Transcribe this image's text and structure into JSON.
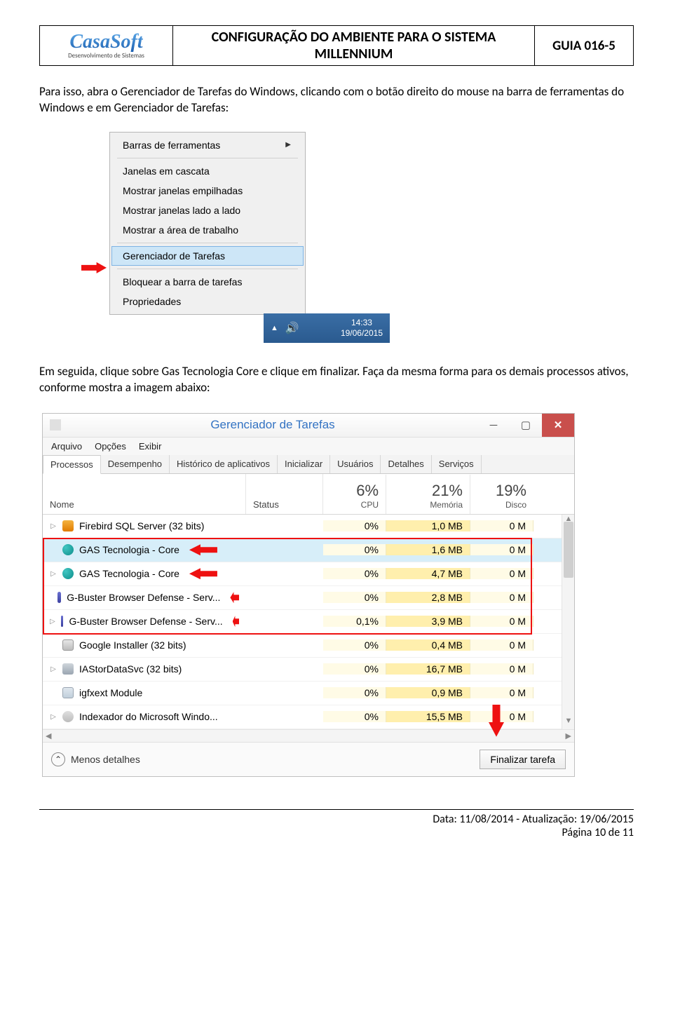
{
  "header": {
    "logo_name": "CasaSoft",
    "logo_sub": "Desenvolvimento de Sistemas",
    "title": "CONFIGURAÇÃO DO AMBIENTE PARA O SISTEMA MILLENNIUM",
    "code": "GUIA 016-5"
  },
  "para1": "Para isso, abra o Gerenciador de Tarefas do Windows, clicando com o botão direito do mouse na barra de ferramentas do Windows e em Gerenciador de Tarefas:",
  "context_menu": {
    "items": [
      "Barras de ferramentas",
      "Janelas em cascata",
      "Mostrar janelas empilhadas",
      "Mostrar janelas lado a lado",
      "Mostrar a área de trabalho",
      "Gerenciador de Tarefas",
      "Bloquear a barra de tarefas",
      "Propriedades"
    ],
    "highlighted_index": 5,
    "tray_time": "14:33",
    "tray_date": "19/06/2015"
  },
  "para2": "Em seguida, clique sobre Gas Tecnologia Core e clique em finalizar. Faça da mesma forma para os demais processos ativos, conforme mostra a imagem abaixo:",
  "task_manager": {
    "title": "Gerenciador de Tarefas",
    "menubar": [
      "Arquivo",
      "Opções",
      "Exibir"
    ],
    "tabs": [
      "Processos",
      "Desempenho",
      "Histórico de aplicativos",
      "Inicializar",
      "Usuários",
      "Detalhes",
      "Serviços"
    ],
    "active_tab_index": 0,
    "col_name": "Nome",
    "col_status": "Status",
    "col_cpu_pct": "6%",
    "col_cpu": "CPU",
    "col_mem_pct": "21%",
    "col_mem": "Memória",
    "col_disk_pct": "19%",
    "col_disk": "Disco",
    "rows": [
      {
        "expand": "▷",
        "icon": "orange",
        "name": "Firebird SQL Server (32 bits)",
        "cpu": "0%",
        "mem": "1,0 MB",
        "disk": "0 M",
        "sel": false,
        "arrow": false
      },
      {
        "expand": "",
        "icon": "teal",
        "name": "GAS Tecnologia - Core",
        "cpu": "0%",
        "mem": "1,6 MB",
        "disk": "0 M",
        "sel": true,
        "arrow": true
      },
      {
        "expand": "▷",
        "icon": "teal",
        "name": "GAS Tecnologia - Core",
        "cpu": "0%",
        "mem": "4,7 MB",
        "disk": "0 M",
        "sel": false,
        "arrow": true
      },
      {
        "expand": "",
        "icon": "shield",
        "name": "G-Buster Browser Defense - Serv...",
        "cpu": "0%",
        "mem": "2,8 MB",
        "disk": "0 M",
        "sel": false,
        "arrow": true
      },
      {
        "expand": "▷",
        "icon": "shield",
        "name": "G-Buster Browser Defense - Serv...",
        "cpu": "0,1%",
        "mem": "3,9 MB",
        "disk": "0 M",
        "sel": false,
        "arrow": true
      },
      {
        "expand": "",
        "icon": "box",
        "name": "Google Installer (32 bits)",
        "cpu": "0%",
        "mem": "0,4 MB",
        "disk": "0 M",
        "sel": false,
        "arrow": false
      },
      {
        "expand": "▷",
        "icon": "disk",
        "name": "IAStorDataSvc (32 bits)",
        "cpu": "0%",
        "mem": "16,7 MB",
        "disk": "0 M",
        "sel": false,
        "arrow": false
      },
      {
        "expand": "",
        "icon": "window",
        "name": "igfxext Module",
        "cpu": "0%",
        "mem": "0,9 MB",
        "disk": "0 M",
        "sel": false,
        "arrow": false
      },
      {
        "expand": "▷",
        "icon": "person",
        "name": "Indexador do Microsoft Windo...",
        "cpu": "0%",
        "mem": "15,5 MB",
        "disk": "0 M",
        "sel": false,
        "arrow": false
      }
    ],
    "fewer_details": "Menos detalhes",
    "end_task": "Finalizar tarefa"
  },
  "footer": {
    "line1": "Data: 11/08/2014 - Atualização: 19/06/2015",
    "line2": "Página 10 de 11"
  }
}
